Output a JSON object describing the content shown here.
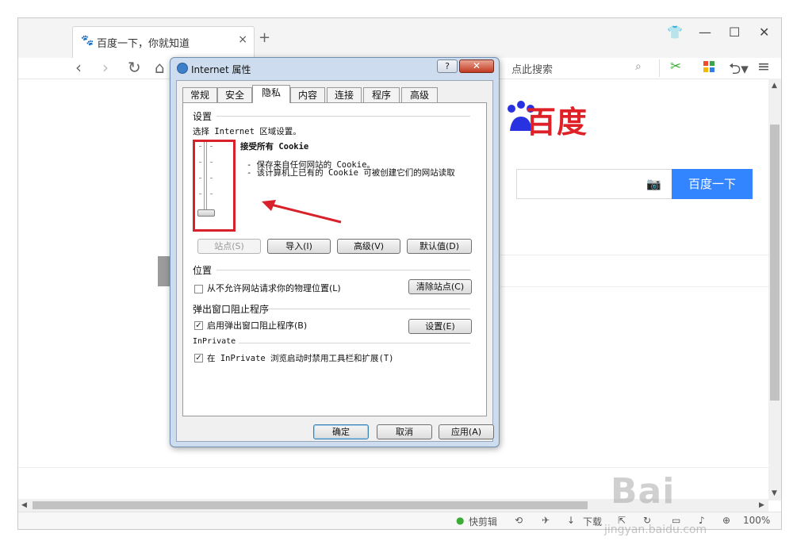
{
  "browser": {
    "tab_title": "百度一下，你就知道",
    "tab_close": "×",
    "new_tab": "+",
    "window_controls": {
      "skin": "skin-icon",
      "minimize": "—",
      "maximize": "☐",
      "close": "✕"
    },
    "nav": {
      "back": "‹",
      "forward": "›",
      "reload": "↻",
      "home": "⌂"
    },
    "search_label": "点此搜索",
    "undo_label": "⮌▾",
    "menu_label": "≡"
  },
  "page": {
    "logo_text": "百度",
    "search_button": "百度一下"
  },
  "statusbar": {
    "clip": "快剪辑",
    "download": "下载",
    "zoom": "100%"
  },
  "dialog": {
    "title": "Internet 属性",
    "help": "?",
    "close": "✕",
    "tabs": [
      "常规",
      "安全",
      "隐私",
      "内容",
      "连接",
      "程序",
      "高级"
    ],
    "active_tab": "隐私",
    "settings": {
      "group_label": "设置",
      "zone_label": "选择 Internet 区域设置。",
      "level_title": "接受所有 Cookie",
      "level_line1": "- 保存来自任何网站的 Cookie。",
      "level_line2": "- 该计算机上已有的 Cookie 可被创建它们的网站读取",
      "slider_level": 0,
      "buttons": {
        "sites": "站点(S)",
        "import": "导入(I)",
        "advanced": "高级(V)",
        "default": "默认值(D)"
      }
    },
    "location": {
      "group_label": "位置",
      "checkbox_label": "从不允许网站请求你的物理位置(L)",
      "checked": false,
      "clear_button": "清除站点(C)"
    },
    "popup": {
      "group_label": "弹出窗口阻止程序",
      "checkbox_label": "启用弹出窗口阻止程序(B)",
      "checked": true,
      "settings_button": "设置(E)"
    },
    "inprivate": {
      "group_label": "InPrivate",
      "checkbox_label": "在 InPrivate 浏览启动时禁用工具栏和扩展(T)",
      "checked": true
    },
    "footer": {
      "ok": "确定",
      "cancel": "取消",
      "apply": "应用(A)"
    }
  },
  "watermark": {
    "main": "Bai",
    "sub": "jingyan.baidu.com"
  },
  "colors": {
    "accent": "#3385ff",
    "baidu_red": "#de2027",
    "annotation_red": "#d8212b",
    "browser_green": "#4db537"
  }
}
